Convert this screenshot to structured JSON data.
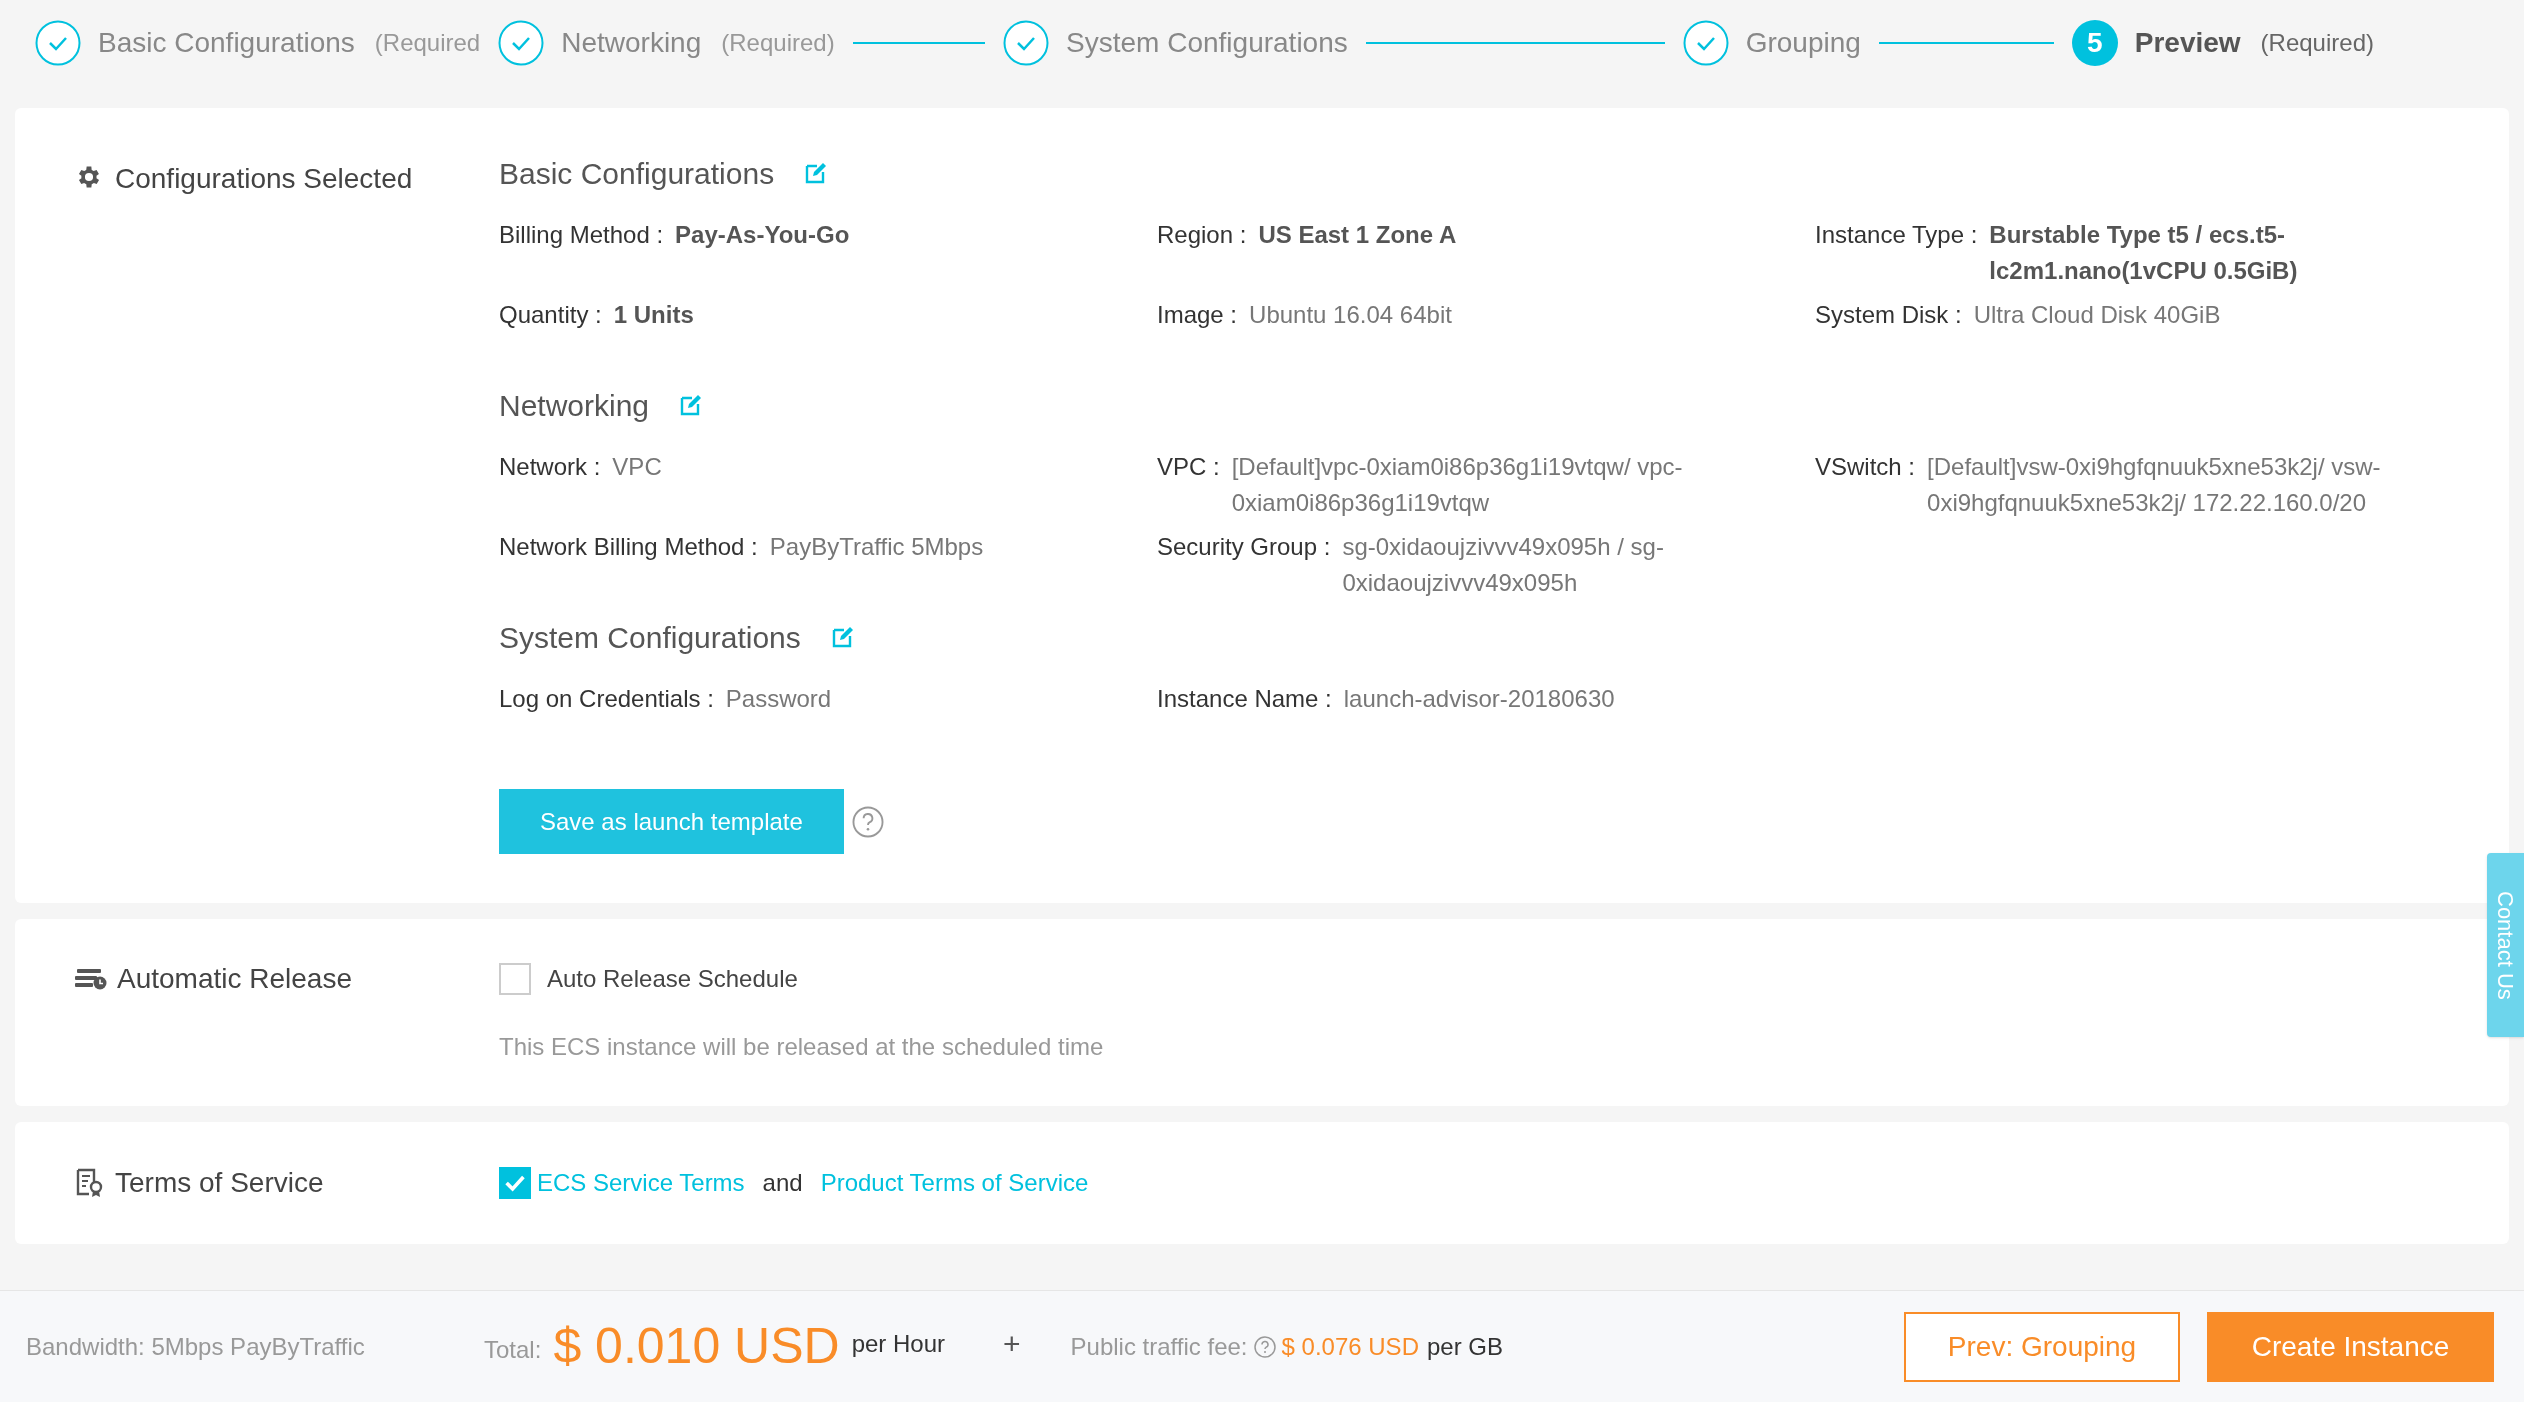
{
  "steps": [
    {
      "label": "Basic Configurations",
      "note": "(Required",
      "completed": true,
      "selected": false,
      "connector_before": false
    },
    {
      "label": "Networking",
      "note": "(Required)",
      "completed": true,
      "selected": false,
      "connector_before": false
    },
    {
      "label": "System Configurations",
      "completed": true,
      "selected": false,
      "connector_before": true
    },
    {
      "label": "Grouping",
      "completed": true,
      "selected": false,
      "connector_before": true
    },
    {
      "label": "Preview",
      "note": "(Required)",
      "number": "5",
      "completed": false,
      "selected": true,
      "connector_before": true
    }
  ],
  "configurations": {
    "title": "Configurations Selected",
    "groups": [
      {
        "title": "Basic Configurations",
        "fields": [
          {
            "label": "Billing Method :",
            "value": "Pay-As-You-Go",
            "emphasis": true
          },
          {
            "label": "Region :",
            "value": "US East 1 Zone A",
            "emphasis": true
          },
          {
            "label": "Instance Type :",
            "value": "Burstable Type t5 / ecs.t5-lc2m1.nano(1vCPU 0.5GiB)",
            "emphasis": true
          },
          {
            "label": "Quantity :",
            "value": "1 Units",
            "emphasis": true
          },
          {
            "label": "Image :",
            "value": "Ubuntu 16.04 64bit",
            "emphasis": false
          },
          {
            "label": "System Disk :",
            "value": "Ultra Cloud Disk 40GiB",
            "emphasis": false
          }
        ]
      },
      {
        "title": "Networking",
        "fields": [
          {
            "label": "Network :",
            "value": "VPC",
            "emphasis": false
          },
          {
            "label": "VPC :",
            "value": "[Default]vpc-0xiam0i86p36g1i19vtqw/ vpc-0xiam0i86p36g1i19vtqw",
            "emphasis": false
          },
          {
            "label": "VSwitch :",
            "value": "[Default]vsw-0xi9hgfqnuuk5xne53k2j/ vsw-0xi9hgfqnuuk5xne53k2j/ 172.22.160.0/20",
            "emphasis": false
          },
          {
            "label": "Network Billing Method :",
            "value": "PayByTraffic 5Mbps",
            "emphasis": false
          },
          {
            "label": "Security Group :",
            "value": "sg-0xidaoujzivvv49x095h / sg-0xidaoujzivvv49x095h",
            "emphasis": false
          }
        ]
      },
      {
        "title": "System Configurations",
        "fields": [
          {
            "label": "Log on Credentials :",
            "value": "Password",
            "emphasis": false
          },
          {
            "label": "Instance Name :",
            "value": "launch-advisor-20180630",
            "emphasis": false
          }
        ]
      }
    ],
    "save_button": "Save as launch template"
  },
  "automatic_release": {
    "title": "Automatic Release",
    "checkbox_label": "Auto Release Schedule",
    "checked": false,
    "description": "This ECS instance will be released at the scheduled time"
  },
  "terms": {
    "title": "Terms of Service",
    "checked": true,
    "link_1": "ECS Service Terms",
    "conjunction": "and",
    "link_2": "Product Terms of Service"
  },
  "contact_tab": "Contact Us",
  "footer": {
    "bandwidth": "Bandwidth: 5Mbps PayByTraffic",
    "total_label": "Total:",
    "total_price": "$ 0.010 USD",
    "total_unit": "per Hour",
    "plus": "+",
    "traffic_label": "Public traffic fee:",
    "traffic_price": "$ 0.076 USD",
    "traffic_unit": "per GB",
    "prev_button": "Prev: Grouping",
    "create_button": "Create Instance"
  }
}
